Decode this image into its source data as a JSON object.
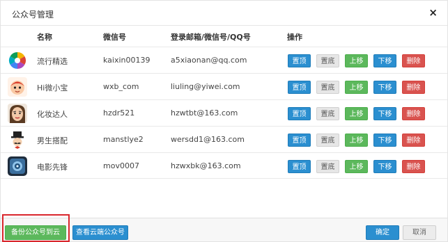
{
  "dialog": {
    "title": "公众号管理",
    "close_glyph": "×"
  },
  "table": {
    "headers": {
      "name": "名称",
      "wechat_id": "微信号",
      "login": "登录邮箱/微信号/QQ号",
      "actions": "操作"
    },
    "rows": [
      {
        "name": "流行精选",
        "wechat_id": "kaixin00139",
        "login": "a5xiaonan@qq.com",
        "avatar_icon": "colorful-shutter-icon"
      },
      {
        "name": "Hi微小宝",
        "wechat_id": "wxb_com",
        "login": "liuling@yiwei.com",
        "avatar_icon": "cartoon-baby-icon"
      },
      {
        "name": "化妆达人",
        "wechat_id": "hzdr521",
        "login": "hzwtbt@163.com",
        "avatar_icon": "makeup-face-icon"
      },
      {
        "name": "男生搭配",
        "wechat_id": "manstlye2",
        "login": "wersdd1@163.com",
        "avatar_icon": "gentleman-icon"
      },
      {
        "name": "电影先锋",
        "wechat_id": "mov0007",
        "login": "hzwxbk@163.com",
        "avatar_icon": "film-app-icon"
      }
    ],
    "action_labels": {
      "top": "置顶",
      "bottom": "置底",
      "up": "上移",
      "down": "下移",
      "delete": "删除"
    }
  },
  "footer": {
    "backup_label": "备份公众号到云端",
    "view_cloud_label": "查看云端公众号",
    "ok_label": "确定",
    "cancel_label": "取消"
  },
  "colors": {
    "primary": "#2b8fd0",
    "success": "#5cb85c",
    "danger": "#d9534f",
    "highlight": "#d9262c"
  }
}
